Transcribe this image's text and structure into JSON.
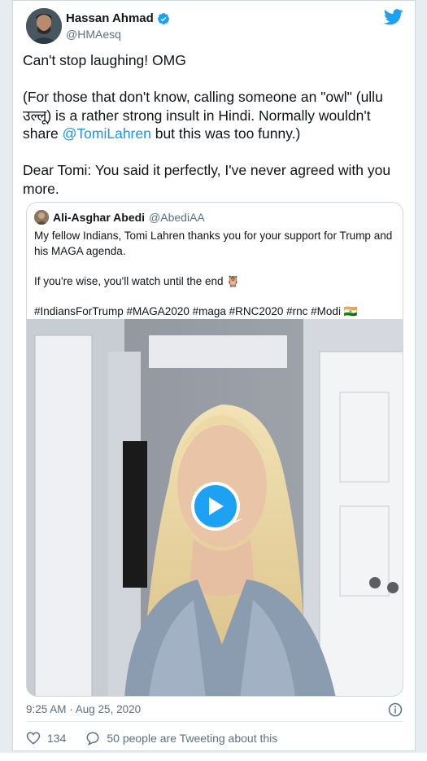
{
  "tweet": {
    "author_name": "Hassan Ahmad",
    "handle": "@HMAesq",
    "text_p1": "Can't stop laughing! OMG",
    "text_p2_before": "(For those that don't know, calling someone an \"owl\" (ullu उल्लू) is a rather strong insult in Hindi. Normally wouldn't share ",
    "mention": "@TomiLahren",
    "text_p2_after": " but this was too funny.)",
    "text_p3": "Dear Tomi: You said it perfectly, I've never agreed with you more.",
    "timestamp": "9:25 AM · Aug 25, 2020",
    "likes": "134",
    "conversation": "50 people are Tweeting about this"
  },
  "quote": {
    "author_name": "Ali-Asghar Abedi",
    "handle": "@AbediAA",
    "line1": "My fellow Indians, Tomi Lahren thanks you for your support for Trump and his MAGA agenda.",
    "line2": "If you're wise, you'll watch until the end 🦉",
    "hashtags": "#IndiansForTrump #MAGA2020 #maga #RNC2020 #rnc #Modi 🇮🇳"
  },
  "colors": {
    "accent": "#1da1f2",
    "link": "#1b95e0",
    "muted": "#5b7083"
  }
}
